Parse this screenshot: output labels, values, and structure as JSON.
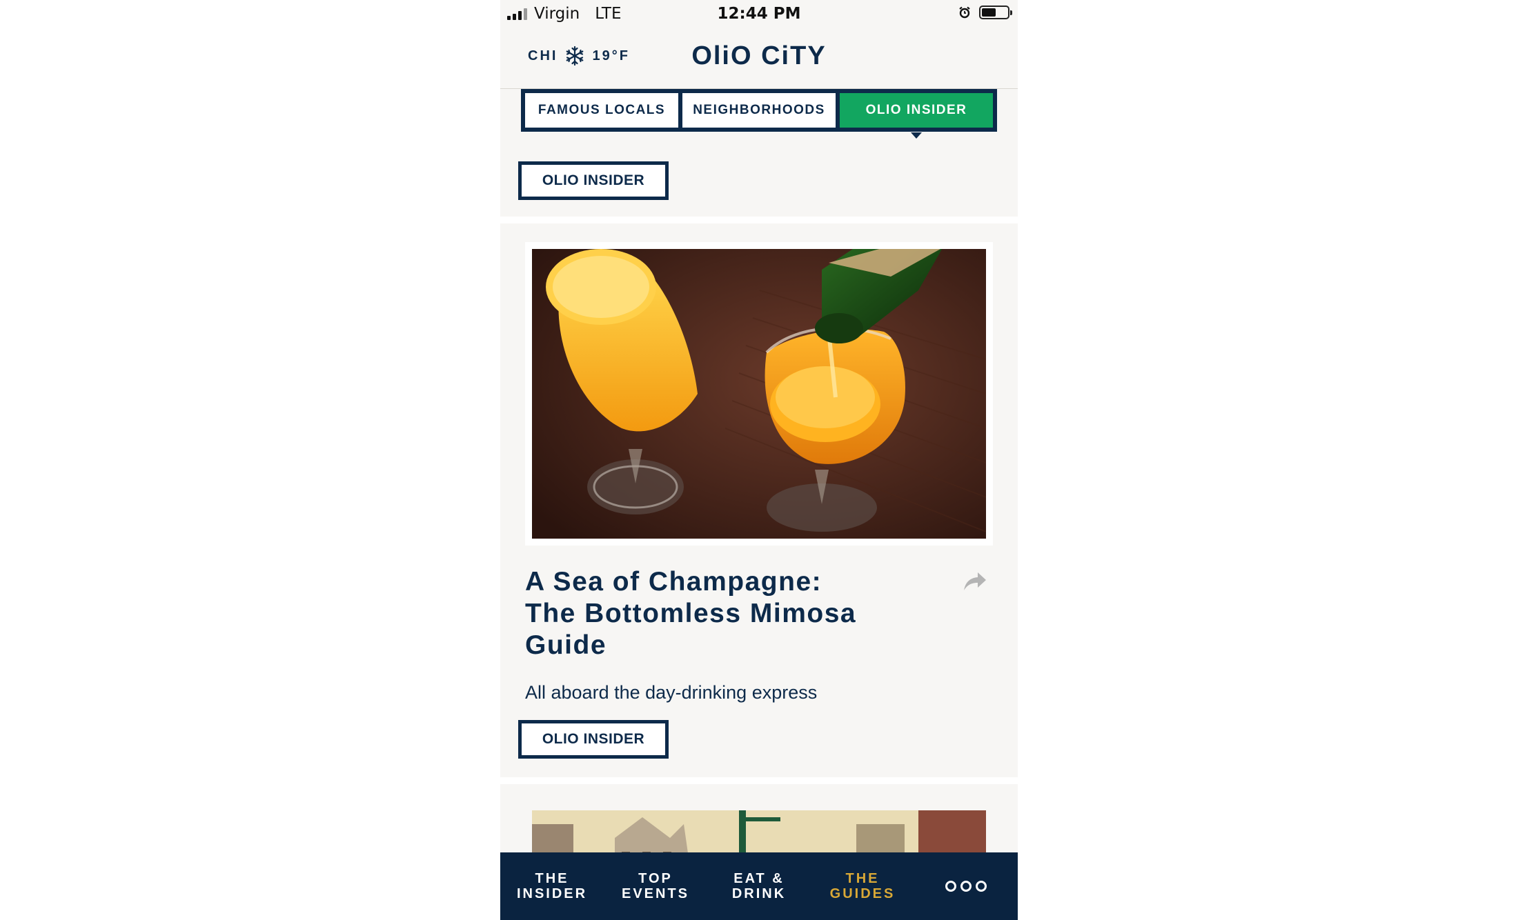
{
  "status_bar": {
    "carrier": "Virgin",
    "network": "LTE",
    "time": "12:44 PM",
    "battery_level": 0.55
  },
  "header": {
    "city": "CHI",
    "temperature": "19°F",
    "weather_icon": "snowflake-icon",
    "logo": "OliO CiTY"
  },
  "tabs": [
    {
      "label": "FAMOUS LOCALS",
      "active": false
    },
    {
      "label": "NEIGHBORHOODS",
      "active": false
    },
    {
      "label": "OLIO INSIDER",
      "active": true
    }
  ],
  "top_panel": {
    "tag_label": "OLIO INSIDER"
  },
  "article": {
    "headline_lines": [
      "A Sea of Champagne:",
      "The Bottomless Mimosa",
      "Guide"
    ],
    "subheadline": "All aboard the day-drinking express",
    "tag_label": "OLIO INSIDER",
    "share_icon": "share-arrow-icon"
  },
  "bottom_nav": {
    "items": [
      {
        "line1": "THE",
        "line2": "INSIDER",
        "active": false
      },
      {
        "line1": "TOP",
        "line2": "EVENTS",
        "active": false
      },
      {
        "line1": "EAT &",
        "line2": "DRINK",
        "active": false
      },
      {
        "line1": "THE",
        "line2": "GUIDES",
        "active": true
      }
    ],
    "more_icon": "more-dots-icon"
  },
  "colors": {
    "navy": "#0d2a4a",
    "green_active": "#12a660",
    "gold_active": "#d9a836",
    "panel_bg": "#f7f6f4"
  }
}
